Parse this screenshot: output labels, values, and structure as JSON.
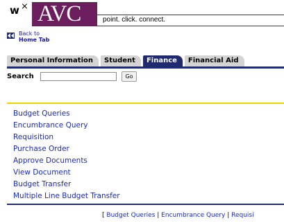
{
  "logo": {
    "w": "w",
    "x": "×",
    "avc": "AVC",
    "tagline": "point. click. connect."
  },
  "back": {
    "line1": "Back to",
    "line2": "Home Tab"
  },
  "tabs": [
    {
      "label": "Personal Information",
      "active": false
    },
    {
      "label": "Student",
      "active": false
    },
    {
      "label": "Finance",
      "active": true
    },
    {
      "label": "Financial Aid",
      "active": false
    }
  ],
  "search": {
    "label": "Search",
    "value": "",
    "button": "Go"
  },
  "menu": [
    "Budget Queries",
    "Encumbrance Query",
    "Requisition",
    "Purchase Order",
    "Approve Documents",
    "View Document",
    "Budget Transfer",
    "Multiple Line Budget Transfer"
  ],
  "footer": {
    "open": "[",
    "items": [
      "Budget Queries",
      "Encumbrance Query",
      "Requisi"
    ],
    "sep": "|"
  },
  "colors": {
    "brand_purple": "#6c1d5d",
    "navy": "#1f2a70",
    "gold": "#f2d200",
    "link": "#1a2bb8"
  }
}
